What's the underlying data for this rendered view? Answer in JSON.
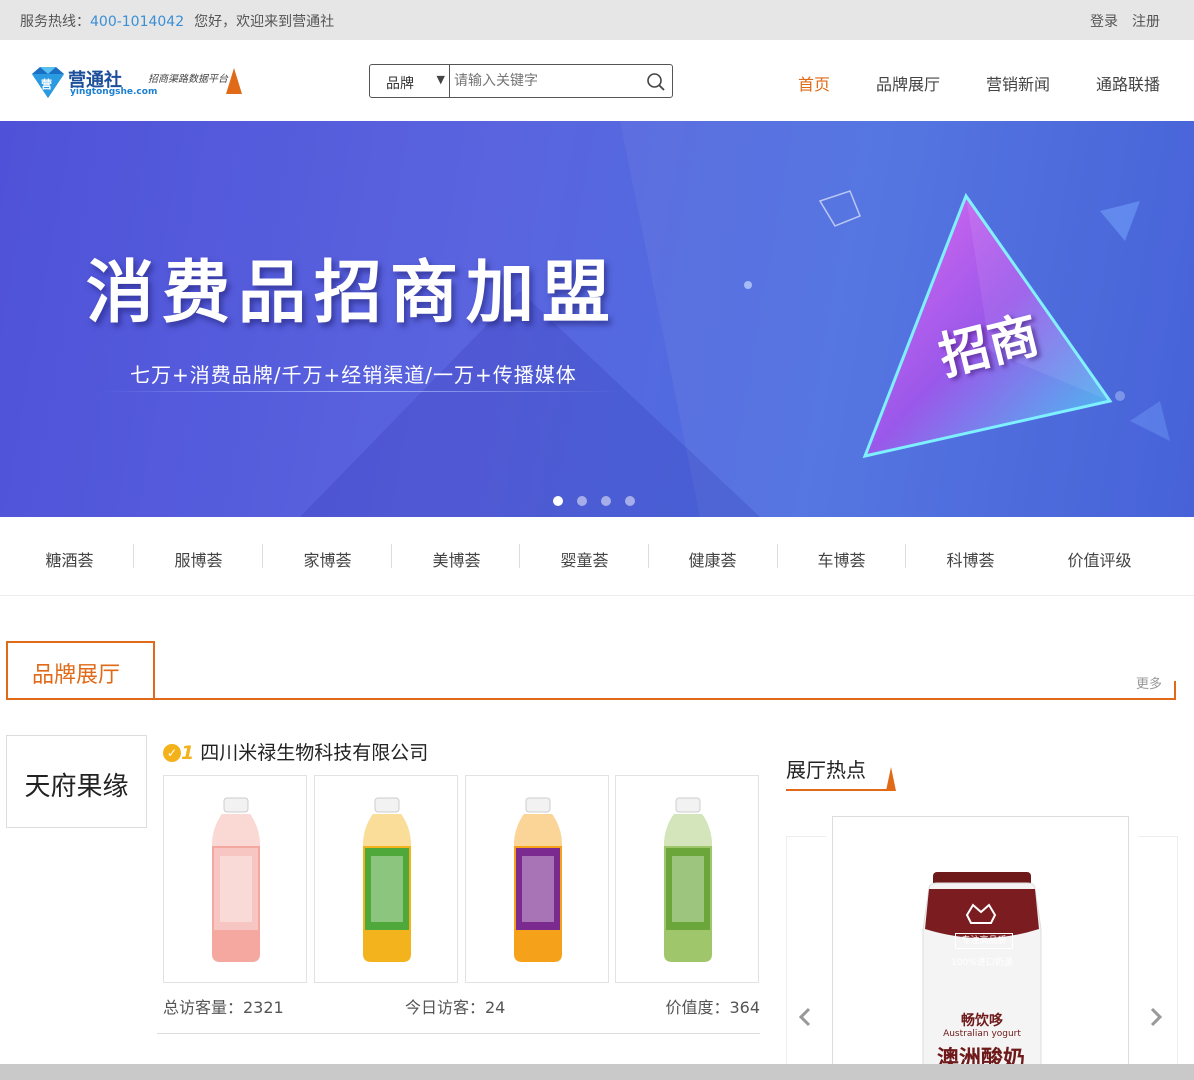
{
  "topbar": {
    "hotline_label": "服务热线：",
    "hotline_number": "400-1014042",
    "welcome": "您好，欢迎来到营通社",
    "login": "登录",
    "register": "注册"
  },
  "header": {
    "logo_name": "营通社",
    "logo_domain": "yingtongshe.com",
    "logo_slogan": "招商渠路数据平台",
    "search": {
      "category": "品牌",
      "placeholder": "请输入关键字"
    },
    "nav": [
      "首页",
      "品牌展厅",
      "营销新闻",
      "通路联播"
    ],
    "active_nav": "首页"
  },
  "banner": {
    "title": "消费品招商加盟",
    "subtitle": "七万+消费品牌/千万+经销渠道/一万+传播媒体",
    "badge": "招商",
    "slide_count": 4,
    "active_slide": 1
  },
  "categories": [
    "糖酒荟",
    "服博荟",
    "家博荟",
    "美博荟",
    "婴童荟",
    "健康荟",
    "车博荟",
    "科博荟",
    "价值评级"
  ],
  "brand_hall": {
    "title": "品牌展厅",
    "more": "更多",
    "brand_logo_text": "天府果缘",
    "rank": "1",
    "company": "四川米禄生物科技有限公司",
    "product_colors": [
      "#f4a8a0",
      "#f2b31c",
      "#f5a21a",
      "#9fc66a"
    ],
    "label_colors": [
      "#f7c6c2",
      "#4fa83a",
      "#7b2a8f",
      "#6aa63a"
    ],
    "stats": {
      "total_visits": "总访客量：2321",
      "today_visits": "今日访客：24",
      "value": "价值度：364"
    }
  },
  "hot": {
    "title": "展厅热点",
    "card": {
      "brand": "畅饮哆",
      "label_top": "专注高品质",
      "label_mid": "100%进口奶源",
      "en_name": "Australian yogurt",
      "cn_name": "澳洲酸奶"
    }
  },
  "colors": {
    "accent": "#e06a17",
    "link": "#3a8fd6",
    "banner_start": "#4f52d8",
    "banner_end": "#3e5ad6"
  }
}
